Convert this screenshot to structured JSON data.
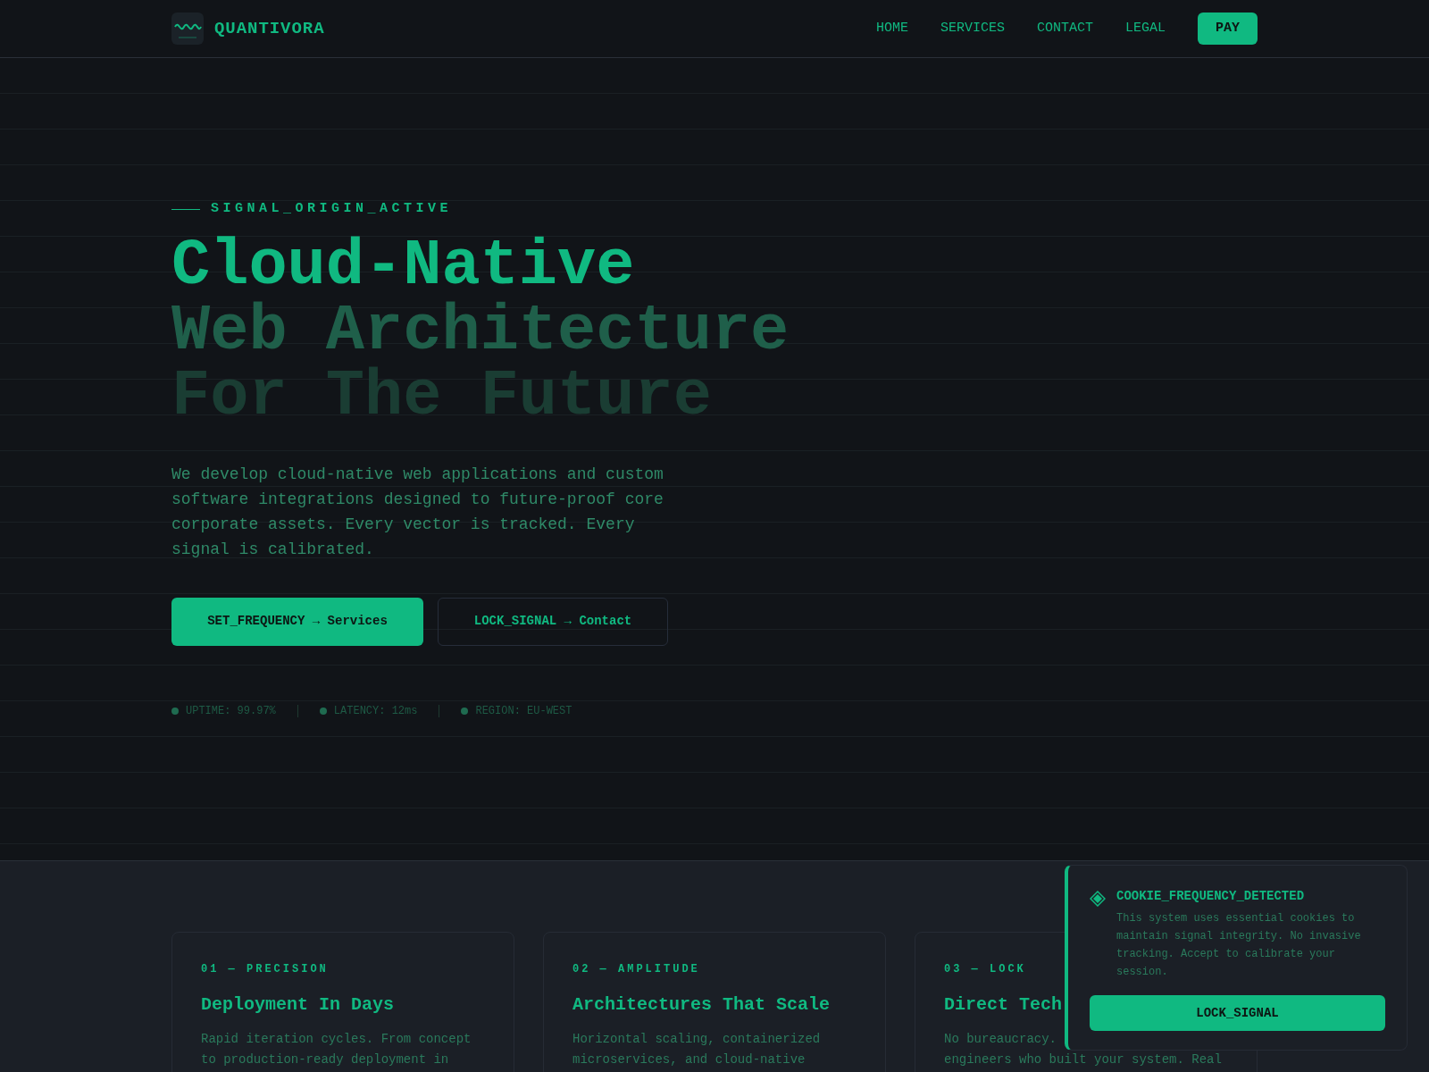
{
  "brand": {
    "name": "QUANTIVORA"
  },
  "nav": {
    "links": [
      "HOME",
      "SERVICES",
      "CONTACT",
      "LEGAL"
    ],
    "cta": "PAY"
  },
  "hero": {
    "eyebrow": "SIGNAL_ORIGIN_ACTIVE",
    "headline": [
      "Cloud-Native",
      "Web Architecture",
      "For The Future"
    ],
    "description": "We develop cloud-native web applications and custom software integrations designed to future-proof core corporate assets. Every vector is tracked. Every signal is calibrated.",
    "buttons": [
      {
        "kind": "primary",
        "label": "SET_FREQUENCY → Services"
      },
      {
        "kind": "outline",
        "label": "LOCK_SIGNAL → Contact"
      }
    ],
    "stats": [
      "UPTIME: 99.97%",
      "LATENCY: 12ms",
      "REGION: EU-WEST"
    ]
  },
  "cards": [
    {
      "eyebrow": "01 — PRECISION",
      "title": "Deployment In Days",
      "lines": [
        "Rapid iteration cycles. From concept",
        "to production-ready deployment in"
      ]
    },
    {
      "eyebrow": "02 — AMPLITUDE",
      "title": "Architectures That Scale",
      "lines": [
        "Horizontal scaling, containerized",
        "microservices, and cloud-native"
      ]
    },
    {
      "eyebrow": "03 — LOCK",
      "title": "Direct Tech",
      "lines": [
        "No bureaucracy.",
        "engineers who built your system. Real"
      ]
    }
  ],
  "cookie": {
    "title": "COOKIE_FREQUENCY_DETECTED",
    "text": "This system uses essential cookies to maintain signal integrity. No invasive tracking. Accept to calibrate your session.",
    "button": "LOCK_SIGNAL"
  }
}
